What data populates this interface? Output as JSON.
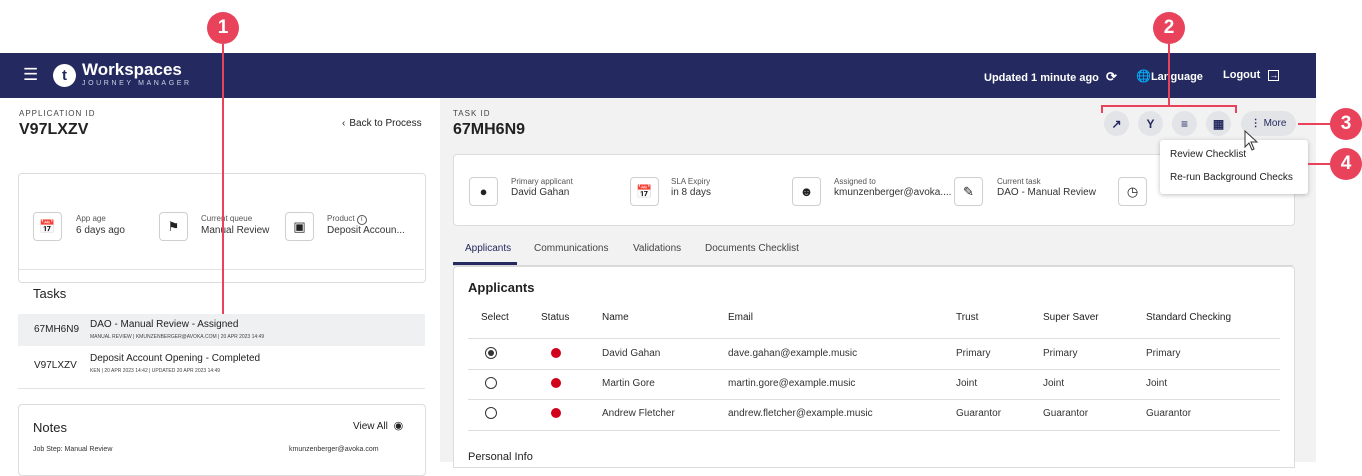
{
  "callouts": [
    "1",
    "2",
    "3",
    "4"
  ],
  "navbar": {
    "logo_letter": "t",
    "app_name": "Workspaces",
    "app_sub": "JOURNEY MANAGER",
    "updated": "Updated 1 minute ago",
    "language": "Language",
    "logout": "Logout"
  },
  "application": {
    "id_label": "APPLICATION ID",
    "id": "V97LXZV",
    "back": "Back to Process",
    "info": [
      {
        "label": "App age",
        "value": "6 days ago",
        "icon": "calendar-icon"
      },
      {
        "label": "Current queue",
        "value": "Manual Review",
        "icon": "flag-icon"
      },
      {
        "label": "Product",
        "value": "Deposit Accoun...",
        "icon": "briefcase-icon"
      }
    ]
  },
  "tasks": {
    "title": "Tasks",
    "items": [
      {
        "id": "67MH6N9",
        "title": "DAO - Manual Review - Assigned",
        "meta": "MANUAL REVIEW | KMUNZENBERGER@AVOKA.COM | 20 APR 2023 14:49"
      },
      {
        "id": "V97LXZV",
        "title": "Deposit Account Opening - Completed",
        "meta": "KEN | 20 APR 2023 14:42 | UPDATED 20 APR 2023 14:49"
      }
    ]
  },
  "notes": {
    "title": "Notes",
    "view_all": "View All",
    "step": "Job Step: Manual Review",
    "author": "kmunzenberger@avoka.com"
  },
  "task": {
    "id_label": "TASK ID",
    "id": "67MH6N9",
    "info": [
      {
        "label": "Primary applicant",
        "value": "David Gahan",
        "icon": "person-icon"
      },
      {
        "label": "SLA Expiry",
        "value": "in 8 days",
        "icon": "calendar-icon"
      },
      {
        "label": "Assigned to",
        "value": "kmunzenberger@avoka....",
        "icon": "account-icon"
      },
      {
        "label": "Current task",
        "value": "DAO - Manual Review",
        "icon": "task-icon"
      }
    ],
    "more": "More",
    "menu": [
      "Review Checklist",
      "Re-run Background Checks"
    ]
  },
  "tabs": [
    "Applicants",
    "Communications",
    "Validations",
    "Documents Checklist"
  ],
  "applicants": {
    "title": "Applicants",
    "columns": [
      "Select",
      "Status",
      "Name",
      "Email",
      "Trust",
      "Super Saver",
      "Standard Checking"
    ],
    "rows": [
      {
        "name": "David Gahan",
        "email": "dave.gahan@example.music",
        "trust": "Primary",
        "saver": "Primary",
        "checking": "Primary"
      },
      {
        "name": "Martin Gore",
        "email": "martin.gore@example.music",
        "trust": "Joint",
        "saver": "Joint",
        "checking": "Joint"
      },
      {
        "name": "Andrew Fletcher",
        "email": "andrew.fletcher@example.music",
        "trust": "Guarantor",
        "saver": "Guarantor",
        "checking": "Guarantor"
      }
    ],
    "personal_info": "Personal Info"
  },
  "colors": {
    "nav": "#242a5f",
    "accent": "#e8435a",
    "status": "#d0021b"
  }
}
